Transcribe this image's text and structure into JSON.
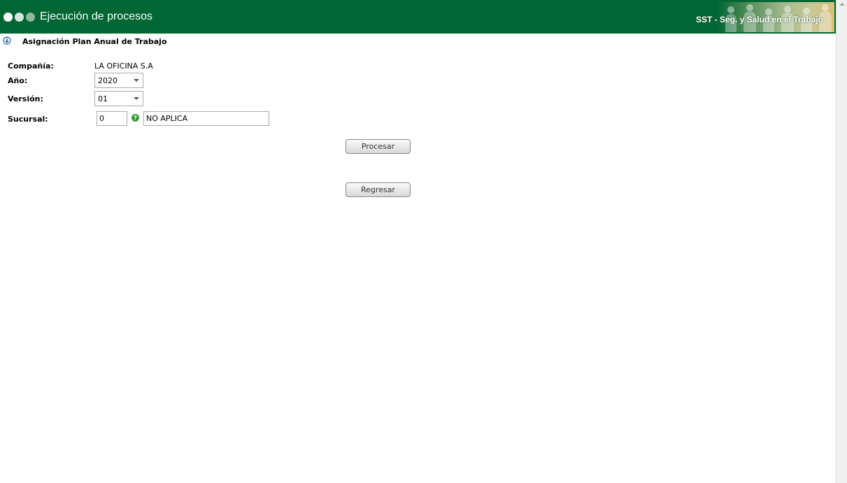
{
  "header": {
    "title": "Ejecución de procesos",
    "app_name": "SST - Seg. y Salud en el Trabajo"
  },
  "section": {
    "title": "Asignación Plan Anual de Trabajo"
  },
  "form": {
    "company_label": "Compañía:",
    "company_value": "LA OFICINA S.A",
    "year_label": "Año:",
    "year_value": "2020",
    "version_label": "Versión:",
    "version_value": "01",
    "branch_label": "Sucursal:",
    "branch_code": "0",
    "branch_name": "NO APLICA"
  },
  "buttons": {
    "process": "Procesar",
    "back": "Regresar"
  },
  "icons": {
    "help": "help-icon",
    "section": "info-arrow-icon"
  },
  "colors": {
    "header_bg": "#006633",
    "help_icon": "#3a9a3a"
  }
}
